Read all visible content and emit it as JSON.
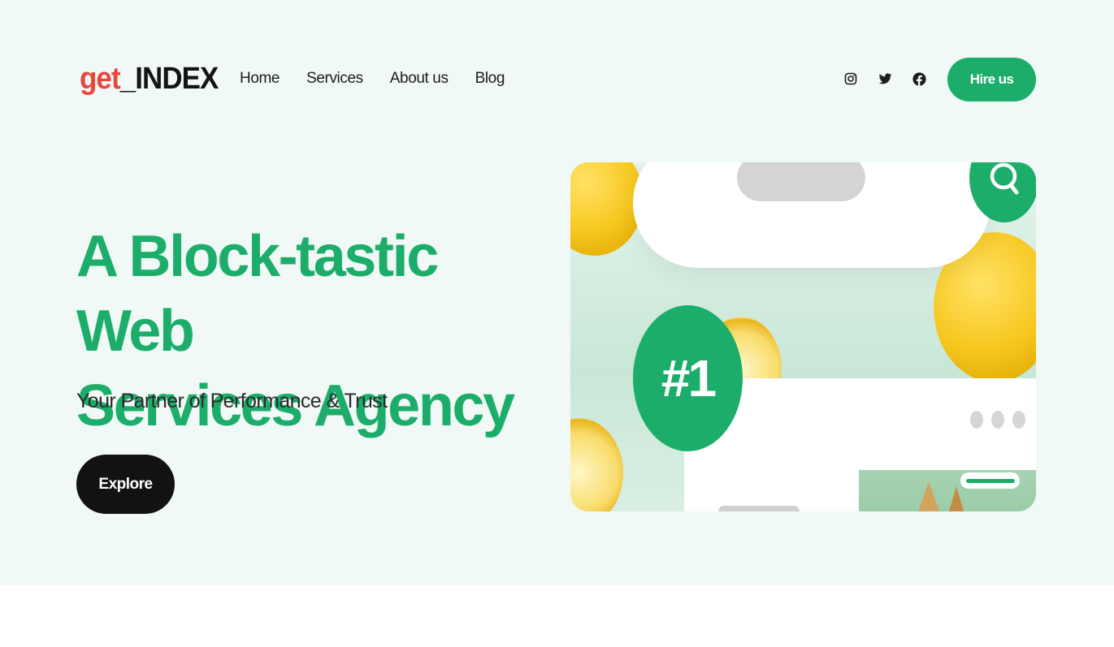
{
  "logo": {
    "part1": "get",
    "part2": "_INDEX"
  },
  "nav": {
    "items": [
      "Home",
      "Services",
      "About us",
      "Blog"
    ]
  },
  "social": [
    "instagram-icon",
    "twitter-icon",
    "facebook-icon"
  ],
  "header": {
    "hire_label": "Hire us"
  },
  "hero": {
    "headline_line1": "A Block-tastic Web",
    "headline_line2": "Services Agency",
    "subline": "Your Partner of Performance & Trust",
    "cta_label": "Explore"
  },
  "illustration": {
    "badge": "#1"
  },
  "colors": {
    "accent": "#1cad6b",
    "logo_red": "#e8473e",
    "background": "#f1f9f6",
    "dark": "#121212"
  }
}
